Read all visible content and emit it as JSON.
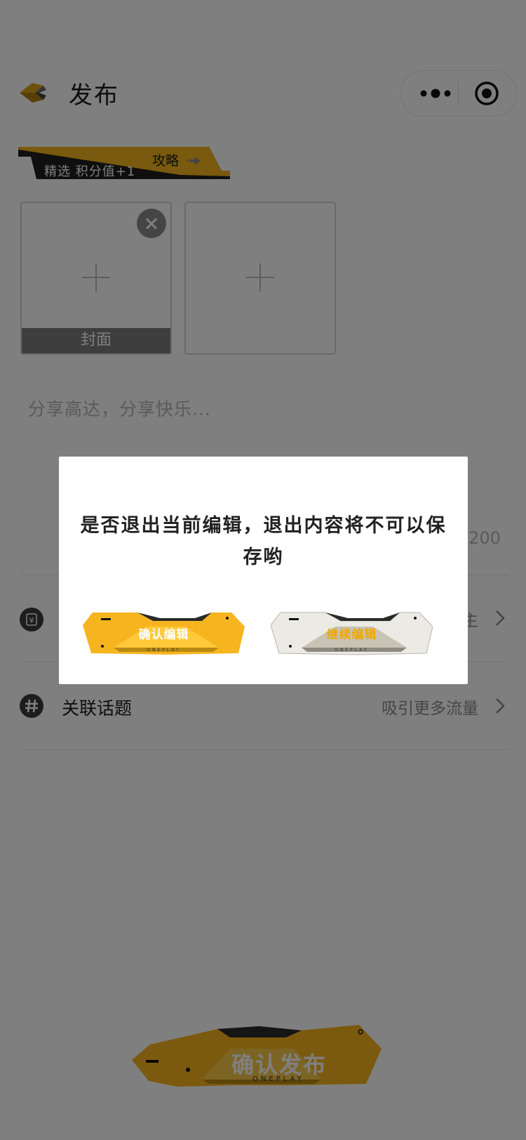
{
  "header": {
    "title": "发布",
    "more_icon": "more-dots-icon",
    "record_icon": "record-icon"
  },
  "tag_banner": {
    "text_left": "精选 积分值+1",
    "text_right": "攻略",
    "accent_color": "#f2b41c"
  },
  "uploader": {
    "cover_label": "封面"
  },
  "editor": {
    "placeholder": "分享高达，分享快乐...",
    "counter": "/200"
  },
  "rows": [
    {
      "icon": "yen-icon",
      "label": "",
      "value": "主"
    },
    {
      "icon": "hashtag-icon",
      "label": "关联话题",
      "value": "吸引更多流量"
    }
  ],
  "publish_button": {
    "label": "确认发布",
    "sub": "ONEPLAY"
  },
  "dialog": {
    "message": "是否退出当前编辑，退出内容将不可以保存哟",
    "confirm_label": "确认编辑",
    "continue_label": "继续编辑",
    "brand_sub": "ONEPLAY"
  },
  "colors": {
    "accent": "#f6b51e",
    "mask": "rgba(0,0,0,0.5)"
  }
}
